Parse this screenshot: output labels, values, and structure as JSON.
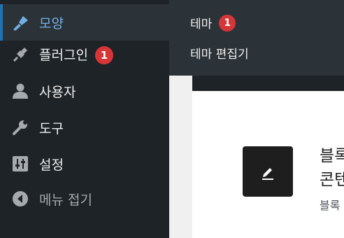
{
  "sidebar": {
    "items": [
      {
        "label": "모양",
        "icon": "paintbrush-icon",
        "active": true
      },
      {
        "label": "플러그인",
        "icon": "plugin-icon",
        "badge": "1"
      },
      {
        "label": "사용자",
        "icon": "user-icon"
      },
      {
        "label": "도구",
        "icon": "wrench-icon"
      },
      {
        "label": "설정",
        "icon": "settings-sliders-icon"
      },
      {
        "label": "메뉴 접기",
        "icon": "collapse-arrow-icon"
      }
    ]
  },
  "submenu": {
    "items": [
      {
        "label": "테마",
        "badge": "1"
      },
      {
        "label": "테마 편집기"
      }
    ]
  },
  "content": {
    "heading_line1": "블록",
    "heading_line2": "콘텐츠",
    "description": "블록"
  },
  "colors": {
    "sidebar_bg": "#1d2327",
    "submenu_bg": "#2c3338",
    "active_text": "#72aee6",
    "badge": "#d63638"
  }
}
